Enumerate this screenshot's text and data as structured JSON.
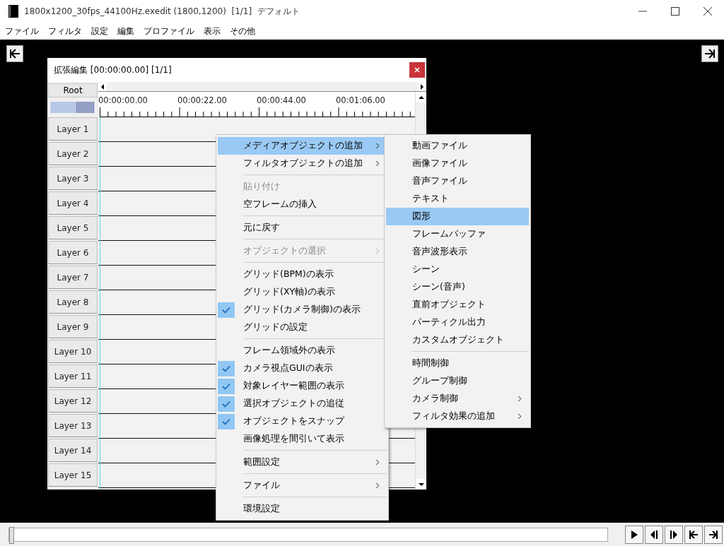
{
  "window": {
    "title": "1800x1200_30fps_44100Hz.exedit (1800,1200)  [1/1]  デフォルト"
  },
  "menu_bar": [
    "ファイル",
    "フィルタ",
    "設定",
    "編集",
    "プロファイル",
    "表示",
    "その他"
  ],
  "editor": {
    "title": "拡張編集 [00:00:00.00] [1/1]",
    "root_label": "Root",
    "time_labels": [
      "00:00:00.00",
      "00:00:22.00",
      "00:00:44.00",
      "00:01:06.00"
    ],
    "layers": [
      "Layer 1",
      "Layer 2",
      "Layer 3",
      "Layer 4",
      "Layer 5",
      "Layer 6",
      "Layer 7",
      "Layer 8",
      "Layer 9",
      "Layer 10",
      "Layer 11",
      "Layer 12",
      "Layer 13",
      "Layer 14",
      "Layer 15"
    ]
  },
  "context_menu": {
    "items": [
      {
        "kind": "item",
        "label": "メディアオブジェクトの追加",
        "submenu": true,
        "selected": true,
        "checked": false,
        "disabled": false
      },
      {
        "kind": "item",
        "label": "フィルタオブジェクトの追加",
        "submenu": true,
        "selected": false,
        "checked": false,
        "disabled": false
      },
      {
        "kind": "separator"
      },
      {
        "kind": "item",
        "label": "貼り付け",
        "submenu": false,
        "selected": false,
        "checked": false,
        "disabled": true
      },
      {
        "kind": "item",
        "label": "空フレームの挿入",
        "submenu": false,
        "selected": false,
        "checked": false,
        "disabled": false
      },
      {
        "kind": "separator"
      },
      {
        "kind": "item",
        "label": "元に戻す",
        "submenu": false,
        "selected": false,
        "checked": false,
        "disabled": false
      },
      {
        "kind": "separator"
      },
      {
        "kind": "item",
        "label": "オブジェクトの選択",
        "submenu": true,
        "selected": false,
        "checked": false,
        "disabled": true
      },
      {
        "kind": "separator"
      },
      {
        "kind": "item",
        "label": "グリッド(BPM)の表示",
        "submenu": false,
        "selected": false,
        "checked": false,
        "disabled": false
      },
      {
        "kind": "item",
        "label": "グリッド(XY軸)の表示",
        "submenu": false,
        "selected": false,
        "checked": false,
        "disabled": false
      },
      {
        "kind": "item",
        "label": "グリッド(カメラ制御)の表示",
        "submenu": false,
        "selected": false,
        "checked": true,
        "disabled": false
      },
      {
        "kind": "item",
        "label": "グリッドの設定",
        "submenu": false,
        "selected": false,
        "checked": false,
        "disabled": false
      },
      {
        "kind": "separator"
      },
      {
        "kind": "item",
        "label": "フレーム領域外の表示",
        "submenu": false,
        "selected": false,
        "checked": false,
        "disabled": false
      },
      {
        "kind": "item",
        "label": "カメラ視点GUIの表示",
        "submenu": false,
        "selected": false,
        "checked": true,
        "disabled": false
      },
      {
        "kind": "item",
        "label": "対象レイヤー範囲の表示",
        "submenu": false,
        "selected": false,
        "checked": true,
        "disabled": false
      },
      {
        "kind": "item",
        "label": "選択オブジェクトの追従",
        "submenu": false,
        "selected": false,
        "checked": true,
        "disabled": false
      },
      {
        "kind": "item",
        "label": "オブジェクトをスナップ",
        "submenu": false,
        "selected": false,
        "checked": true,
        "disabled": false
      },
      {
        "kind": "item",
        "label": "画像処理を間引いて表示",
        "submenu": false,
        "selected": false,
        "checked": false,
        "disabled": false
      },
      {
        "kind": "separator"
      },
      {
        "kind": "item",
        "label": "範囲設定",
        "submenu": true,
        "selected": false,
        "checked": false,
        "disabled": false
      },
      {
        "kind": "separator"
      },
      {
        "kind": "item",
        "label": "ファイル",
        "submenu": true,
        "selected": false,
        "checked": false,
        "disabled": false
      },
      {
        "kind": "separator"
      },
      {
        "kind": "item",
        "label": "環境設定",
        "submenu": false,
        "selected": false,
        "checked": false,
        "disabled": false
      }
    ]
  },
  "submenu": {
    "items": [
      {
        "kind": "item",
        "label": "動画ファイル",
        "submenu": false,
        "selected": false
      },
      {
        "kind": "item",
        "label": "画像ファイル",
        "submenu": false,
        "selected": false
      },
      {
        "kind": "item",
        "label": "音声ファイル",
        "submenu": false,
        "selected": false
      },
      {
        "kind": "item",
        "label": "テキスト",
        "submenu": false,
        "selected": false
      },
      {
        "kind": "item",
        "label": "図形",
        "submenu": false,
        "selected": true
      },
      {
        "kind": "item",
        "label": "フレームバッファ",
        "submenu": false,
        "selected": false
      },
      {
        "kind": "item",
        "label": "音声波形表示",
        "submenu": false,
        "selected": false
      },
      {
        "kind": "item",
        "label": "シーン",
        "submenu": false,
        "selected": false
      },
      {
        "kind": "item",
        "label": "シーン(音声)",
        "submenu": false,
        "selected": false
      },
      {
        "kind": "item",
        "label": "直前オブジェクト",
        "submenu": false,
        "selected": false
      },
      {
        "kind": "item",
        "label": "パーティクル出力",
        "submenu": false,
        "selected": false
      },
      {
        "kind": "item",
        "label": "カスタムオブジェクト",
        "submenu": false,
        "selected": false
      },
      {
        "kind": "separator"
      },
      {
        "kind": "item",
        "label": "時間制御",
        "submenu": false,
        "selected": false
      },
      {
        "kind": "item",
        "label": "グループ制御",
        "submenu": false,
        "selected": false
      },
      {
        "kind": "item",
        "label": "カメラ制御",
        "submenu": true,
        "selected": false
      },
      {
        "kind": "item",
        "label": "フィルタ効果の追加",
        "submenu": true,
        "selected": false
      }
    ]
  },
  "seek": {
    "level": 0
  }
}
